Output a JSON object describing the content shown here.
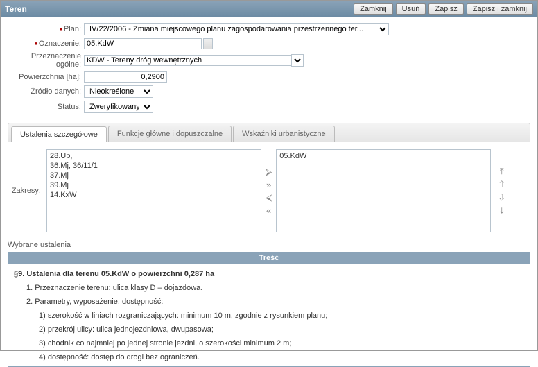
{
  "title": "Teren",
  "buttons": {
    "close": "Zamknij",
    "delete": "Usuń",
    "save": "Zapisz",
    "saveclose": "Zapisz i zamknij"
  },
  "form": {
    "plan_label": "Plan:",
    "plan_value": "IV/22/2006 - Zmiana miejscowego planu zagospodarowania przestrzennego ter...",
    "ozn_label": "Oznaczenie:",
    "ozn_value": "05.KdW",
    "przezn_label": "Przeznaczenie ogólne:",
    "przezn_value": "KDW - Tereny dróg wewnętrznych",
    "pow_label": "Powierzchnia [ha]:",
    "pow_value": "0,2900",
    "zrodlo_label": "Źródło danych:",
    "zrodlo_value": "Nieokreślone",
    "status_label": "Status:",
    "status_value": "Zweryfikowany"
  },
  "tabs": {
    "t1": "Ustalenia szczegółowe",
    "t2": "Funkcje główne i dopuszczalne",
    "t3": "Wskaźniki urbanistyczne"
  },
  "zakresy_label": "Zakresy:",
  "left_list": [
    "28.Up,",
    "36.Mj, 36/11/1",
    "37.Mj",
    "39.Mj",
    "14.KxW"
  ],
  "right_list": [
    "05.KdW"
  ],
  "selected_header": "Wybrane ustalenia",
  "content_title": "Treść",
  "content": {
    "p0": "§9. Ustalenia dla terenu 05.KdW o powierzchni 0,287 ha",
    "p1": "1. Przeznaczenie terenu: ulica klasy D – dojazdowa.",
    "p2": "2. Parametry, wyposażenie, dostępność:",
    "s1": "1) szerokość w liniach rozgraniczających: minimum 10 m, zgodnie z rysunkiem planu;",
    "s2": "2) przekrój ulicy: ulica jednojezdniowa, dwupasowa;",
    "s3": "3) chodnik co najmniej po jednej stronie jezdni, o szerokości minimum 2 m;",
    "s4": "4) dostępność: dostęp do drogi bez ograniczeń."
  }
}
